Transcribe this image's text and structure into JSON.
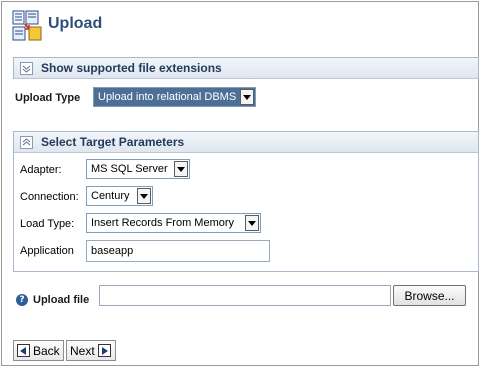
{
  "page": {
    "title": "Upload"
  },
  "extensions_section": {
    "label": "Show supported file extensions",
    "collapsed": true
  },
  "upload_type": {
    "label": "Upload Type",
    "value": "Upload into relational DBMS"
  },
  "target_section": {
    "label": "Select Target Parameters",
    "collapsed": false,
    "adapter": {
      "label": "Adapter:",
      "value": "MS SQL Server"
    },
    "connection": {
      "label": "Connection:",
      "value": "Century"
    },
    "load_type": {
      "label": "Load Type:",
      "value": "Insert Records From Memory"
    },
    "application": {
      "label": "Application",
      "value": "baseapp"
    }
  },
  "upload_file": {
    "label": "Upload file",
    "value": "",
    "browse_label": "Browse..."
  },
  "navigation": {
    "back_label": "Back",
    "next_label": "Next"
  },
  "icons": {
    "title": "upload-icon",
    "help": "help-icon",
    "expand": "chevron-down-icon",
    "collapse": "chevron-up-icon",
    "back": "arrow-left-icon",
    "next": "arrow-right-icon"
  }
}
